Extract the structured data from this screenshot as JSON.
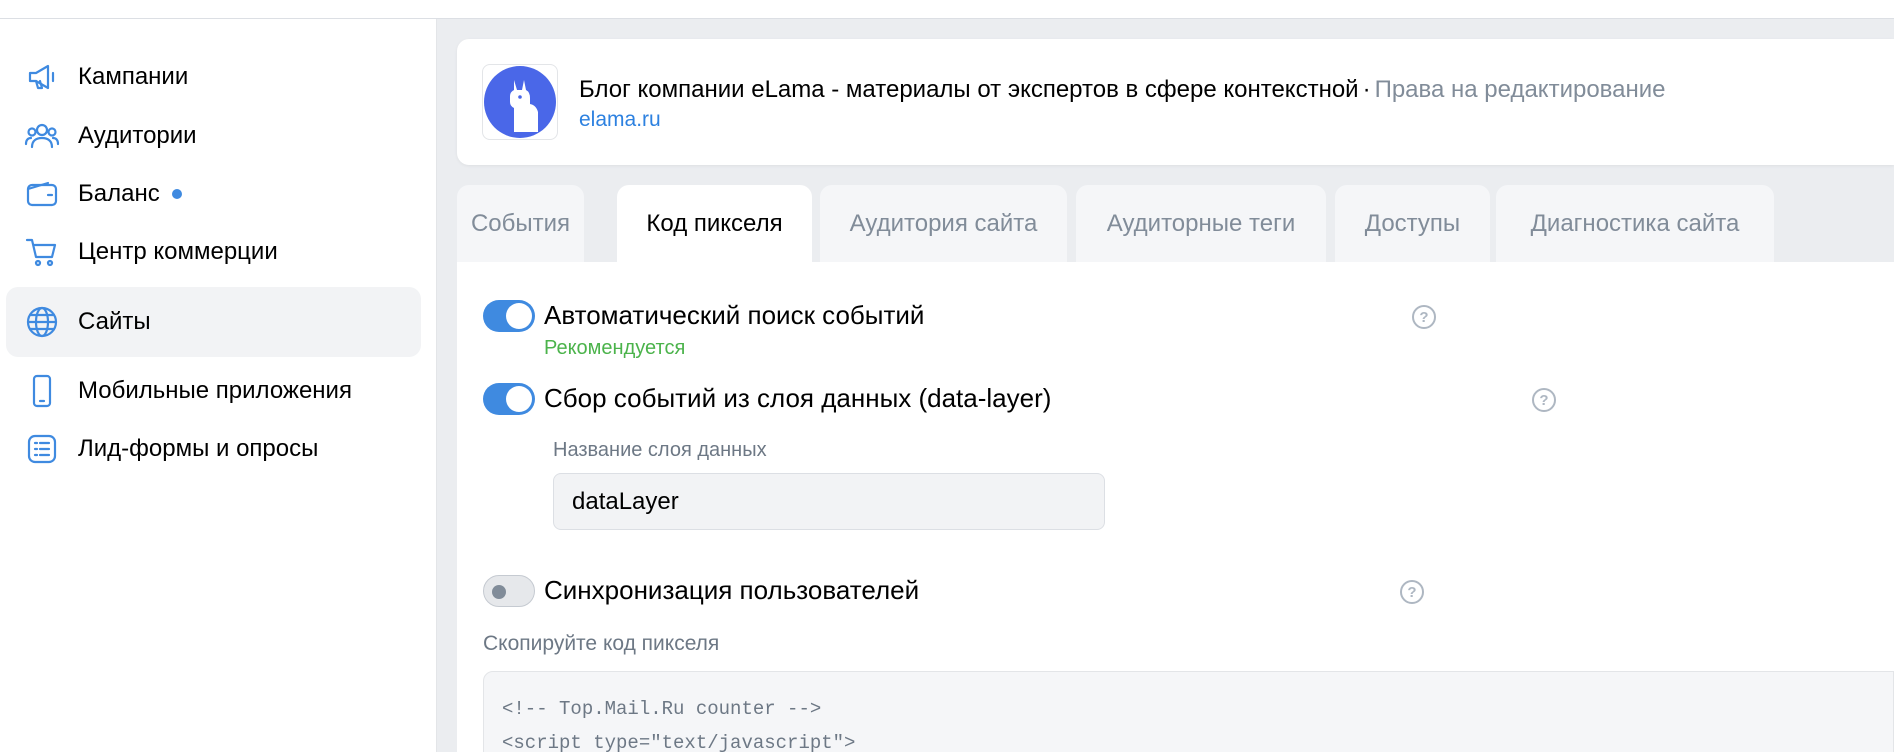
{
  "sidebar": {
    "items": [
      {
        "label": "Кампании",
        "icon": "megaphone-icon"
      },
      {
        "label": "Аудитории",
        "icon": "users-icon"
      },
      {
        "label": "Баланс",
        "icon": "wallet-icon",
        "has_dot": true
      },
      {
        "label": "Центр коммерции",
        "icon": "cart-icon"
      },
      {
        "label": "Сайты",
        "icon": "globe-icon",
        "active": true
      },
      {
        "label": "Мобильные приложения",
        "icon": "phone-icon"
      },
      {
        "label": "Лид-формы и опросы",
        "icon": "list-icon"
      }
    ]
  },
  "header": {
    "title": "Блог компании eLama - материалы от экспертов в сфере контекстной",
    "separator": "·",
    "rights": "Права на редактирование",
    "domain": "elama.ru",
    "logo_icon": "llama-logo-icon"
  },
  "tabs": [
    {
      "label": "События"
    },
    {
      "label": "Код пикселя",
      "active": true
    },
    {
      "label": "Аудитория сайта"
    },
    {
      "label": "Аудиторные теги"
    },
    {
      "label": "Доступы"
    },
    {
      "label": "Диагностика сайта"
    }
  ],
  "settings": {
    "auto_events": {
      "label": "Автоматический поиск событий",
      "enabled": true,
      "note": "Рекомендуется"
    },
    "data_layer": {
      "label": "Сбор событий из слоя данных (data-layer)",
      "enabled": true,
      "field_caption": "Название слоя данных",
      "field_value": "dataLayer"
    },
    "user_sync": {
      "label": "Синхронизация пользователей",
      "enabled": false
    },
    "help_glyph": "?"
  },
  "code": {
    "caption": "Скопируйте код пикселя",
    "lines": [
      "<!-- Top.Mail.Ru counter -->",
      "<script type=\"text/javascript\">"
    ]
  },
  "colors": {
    "accent": "#3f8ae0",
    "recommend": "#4bb34b",
    "logo_bg": "#4a67e8"
  }
}
